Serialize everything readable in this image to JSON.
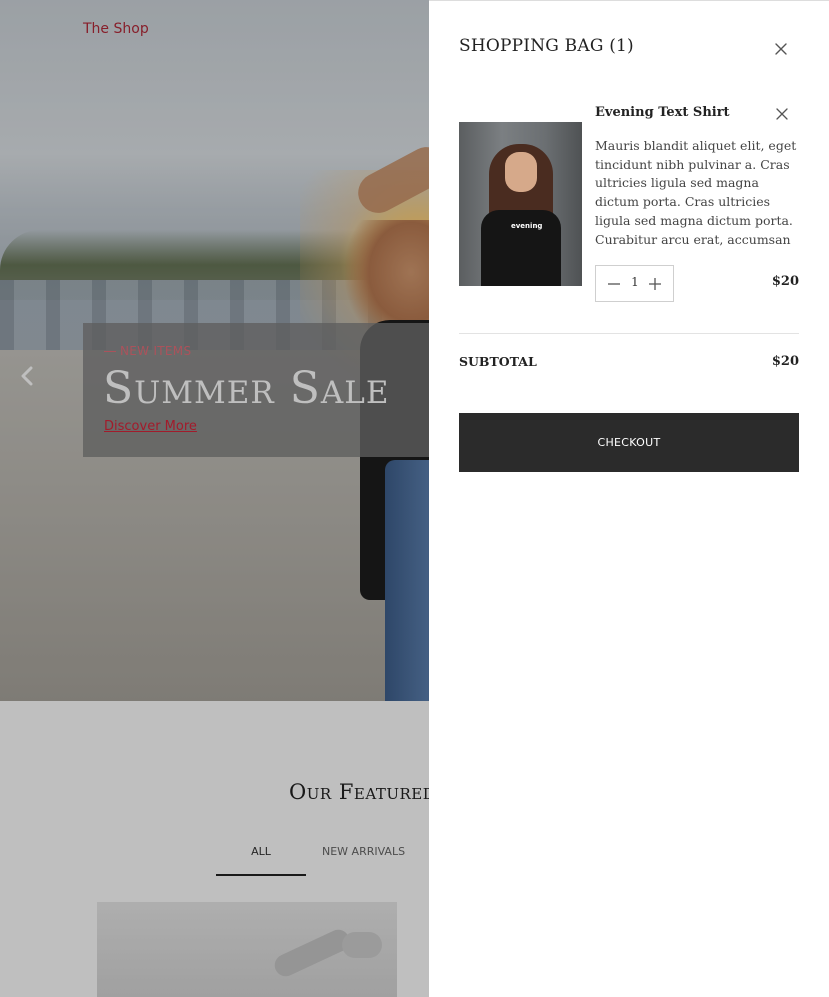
{
  "header": {
    "shop_link": "The Shop"
  },
  "hero": {
    "kicker": "NEW ITEMS",
    "title": "Summer Sale",
    "link": "Discover More",
    "prev_icon": "chevron-left-icon"
  },
  "featured": {
    "title": "Our Featured",
    "tabs": [
      {
        "label": "ALL",
        "active": true
      },
      {
        "label": "NEW ARRIVALS",
        "active": false
      }
    ]
  },
  "cart": {
    "title": "SHOPPING BAG (1)",
    "close_icon": "close-icon",
    "items": [
      {
        "name": "Evening Text Shirt",
        "description": "Mauris blandit aliquet elit, eget tincidunt nibh pulvinar a. Cras ultricies ligula sed magna dictum porta. Cras ultricies ligula sed magna dictum porta. Curabitur arcu erat, accumsan",
        "quantity": "1",
        "price": "$20",
        "shirt_text": "evening",
        "remove_icon": "close-icon"
      }
    ],
    "subtotal_label": "SUBTOTAL",
    "subtotal_value": "$20",
    "checkout_label": "CHECKOUT"
  },
  "colors": {
    "accent_red": "#b52a3a",
    "checkout_bg": "#2b2b2b",
    "overlay": "rgba(0,0,0,0.25)"
  }
}
